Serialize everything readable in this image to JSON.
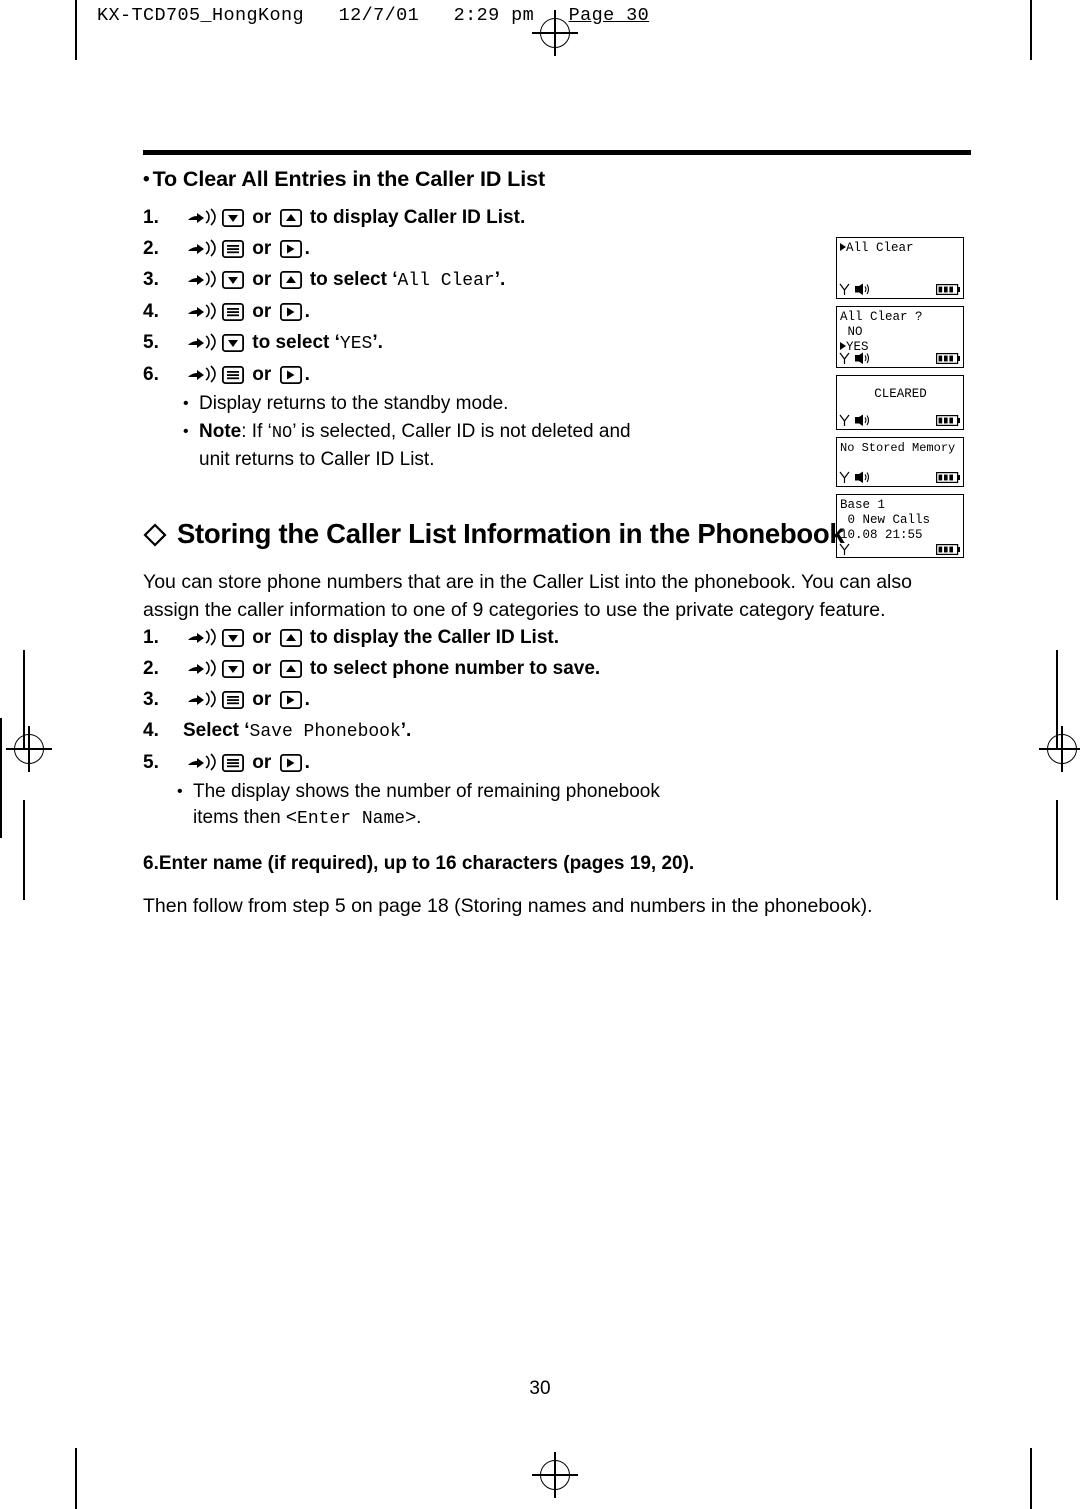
{
  "print_header": {
    "file": "KX-TCD705_HongKong",
    "date": "12/7/01",
    "time": "2:29 pm",
    "page_label": "Page 30"
  },
  "section_clear": {
    "heading": "To Clear All Entries in the Caller ID List",
    "steps": [
      {
        "num": "1.",
        "text_before": " or ",
        "text_after": " to display Caller ID List."
      },
      {
        "num": "2.",
        "text_before": " or ",
        "text_after": "."
      },
      {
        "num": "3.",
        "text_before": " or ",
        "text_after": " to select ‘",
        "mono": "All Clear",
        "text_end": "’."
      },
      {
        "num": "4.",
        "text_before": " or ",
        "text_after": "."
      },
      {
        "num": "5.",
        "text_before": " to select ‘",
        "mono": "YES",
        "text_end": "’."
      },
      {
        "num": "6.",
        "text_before": " or ",
        "text_after": "."
      }
    ],
    "notes": [
      "Display returns to the standby mode.",
      "Note: If ‘NO’ is selected, Caller ID is not deleted and"
    ],
    "note_label": "Note",
    "note_mono": "NO",
    "note_continuation": "unit returns to Caller ID List."
  },
  "lcd_screens": [
    {
      "name": "all-clear",
      "lines": [
        "All Clear"
      ],
      "pointer_line": 0,
      "show_status": true
    },
    {
      "name": "all-clear-confirm",
      "lines": [
        "All Clear ?",
        " NO",
        "YES"
      ],
      "pointer_line": 2,
      "show_status": true
    },
    {
      "name": "cleared",
      "lines": [
        "CLEARED"
      ],
      "centered": true,
      "show_status": true
    },
    {
      "name": "no-stored-memory",
      "lines": [
        "No Stored Memory"
      ],
      "show_status": true
    },
    {
      "name": "standby",
      "lines": [
        "Base 1",
        " 0 New Calls",
        "10.08 21:55"
      ],
      "show_status": true
    }
  ],
  "section_store": {
    "heading": "Storing the Caller List Information in the Phonebook",
    "intro": "You can store phone numbers that are in the Caller List into the phonebook. You can also assign the caller information to one of 9 categories to use the private category feature.",
    "steps": [
      {
        "num": "1.",
        "text_before": " or ",
        "text_after": " to display the Caller ID List."
      },
      {
        "num": "2.",
        "text_before": " or ",
        "text_after": " to select phone number to save."
      },
      {
        "num": "3.",
        "text_before": " or ",
        "text_after": "."
      },
      {
        "num": "4.",
        "select_label": "Select",
        "mono": "Save Phonebook",
        "quote_open": " ‘",
        "quote_close": "’."
      },
      {
        "num": "5.",
        "text_before": " or ",
        "text_after": "."
      }
    ],
    "note_line1": "The display shows the number of remaining phonebook",
    "note_line2_before": "items then <",
    "note_line2_mono": "Enter Name",
    "note_line2_after": ">.",
    "step6": {
      "num": "6.",
      "text": "Enter name (if required), up to 16 characters (pages 19, 20)."
    },
    "closing": "Then follow from step 5 on page 18 (Storing names and numbers in the phonebook)."
  },
  "footer": {
    "page_number": "30"
  }
}
